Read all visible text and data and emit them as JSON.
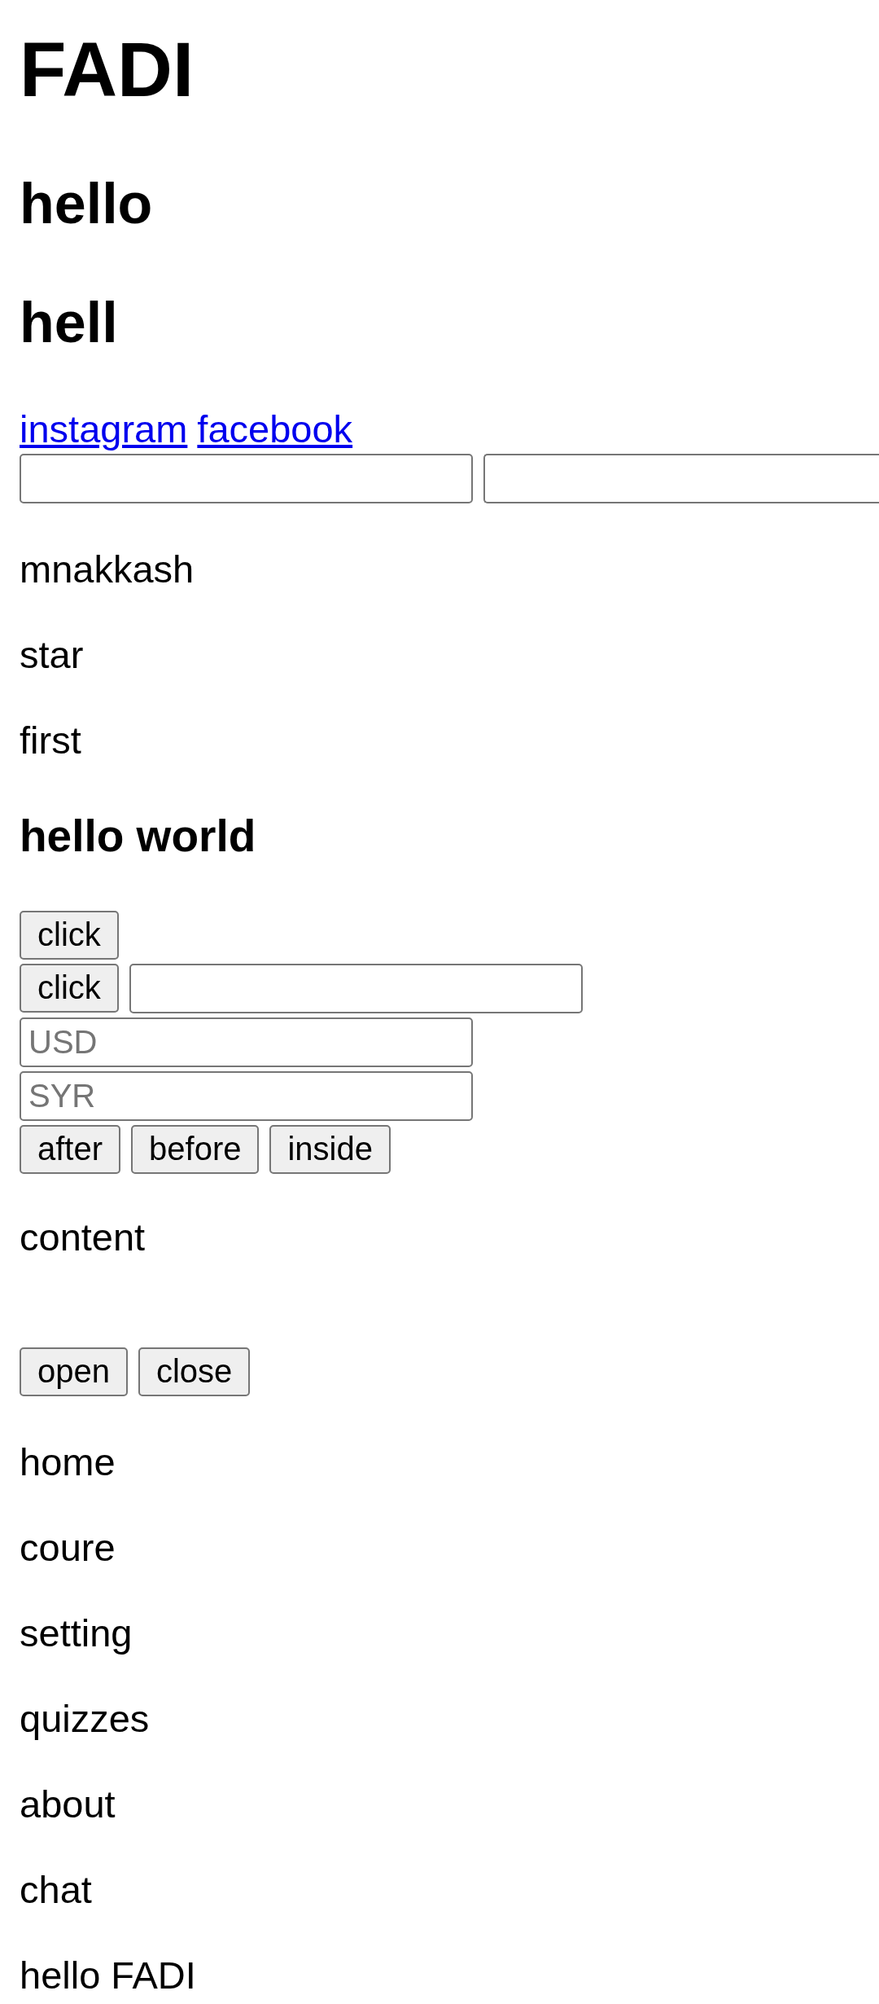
{
  "title": "FADI",
  "headings": [
    "hello",
    "hell"
  ],
  "links": [
    {
      "label": "instagram"
    },
    {
      "label": "facebook"
    }
  ],
  "input_row": [
    {
      "kind": "input"
    },
    {
      "kind": "input"
    }
  ],
  "paragraphs": [
    "mnakkash",
    "star",
    "first"
  ],
  "subheading": "hello world",
  "form_rows": [
    [
      {
        "kind": "button",
        "label": "click"
      }
    ],
    [
      {
        "kind": "button",
        "label": "click"
      },
      {
        "kind": "input"
      }
    ],
    [
      {
        "kind": "input",
        "placeholder": "USD"
      }
    ],
    [
      {
        "kind": "input",
        "placeholder": "SYR"
      }
    ],
    [
      {
        "kind": "button",
        "label": "after"
      },
      {
        "kind": "button",
        "label": "before"
      },
      {
        "kind": "button",
        "label": "inside"
      }
    ]
  ],
  "content_text": "content",
  "toggle_buttons": [
    {
      "label": "open"
    },
    {
      "label": "close"
    }
  ],
  "lines": [
    "home",
    "coure",
    "setting",
    "quizzes",
    "about",
    "chat",
    "hello FADI"
  ]
}
